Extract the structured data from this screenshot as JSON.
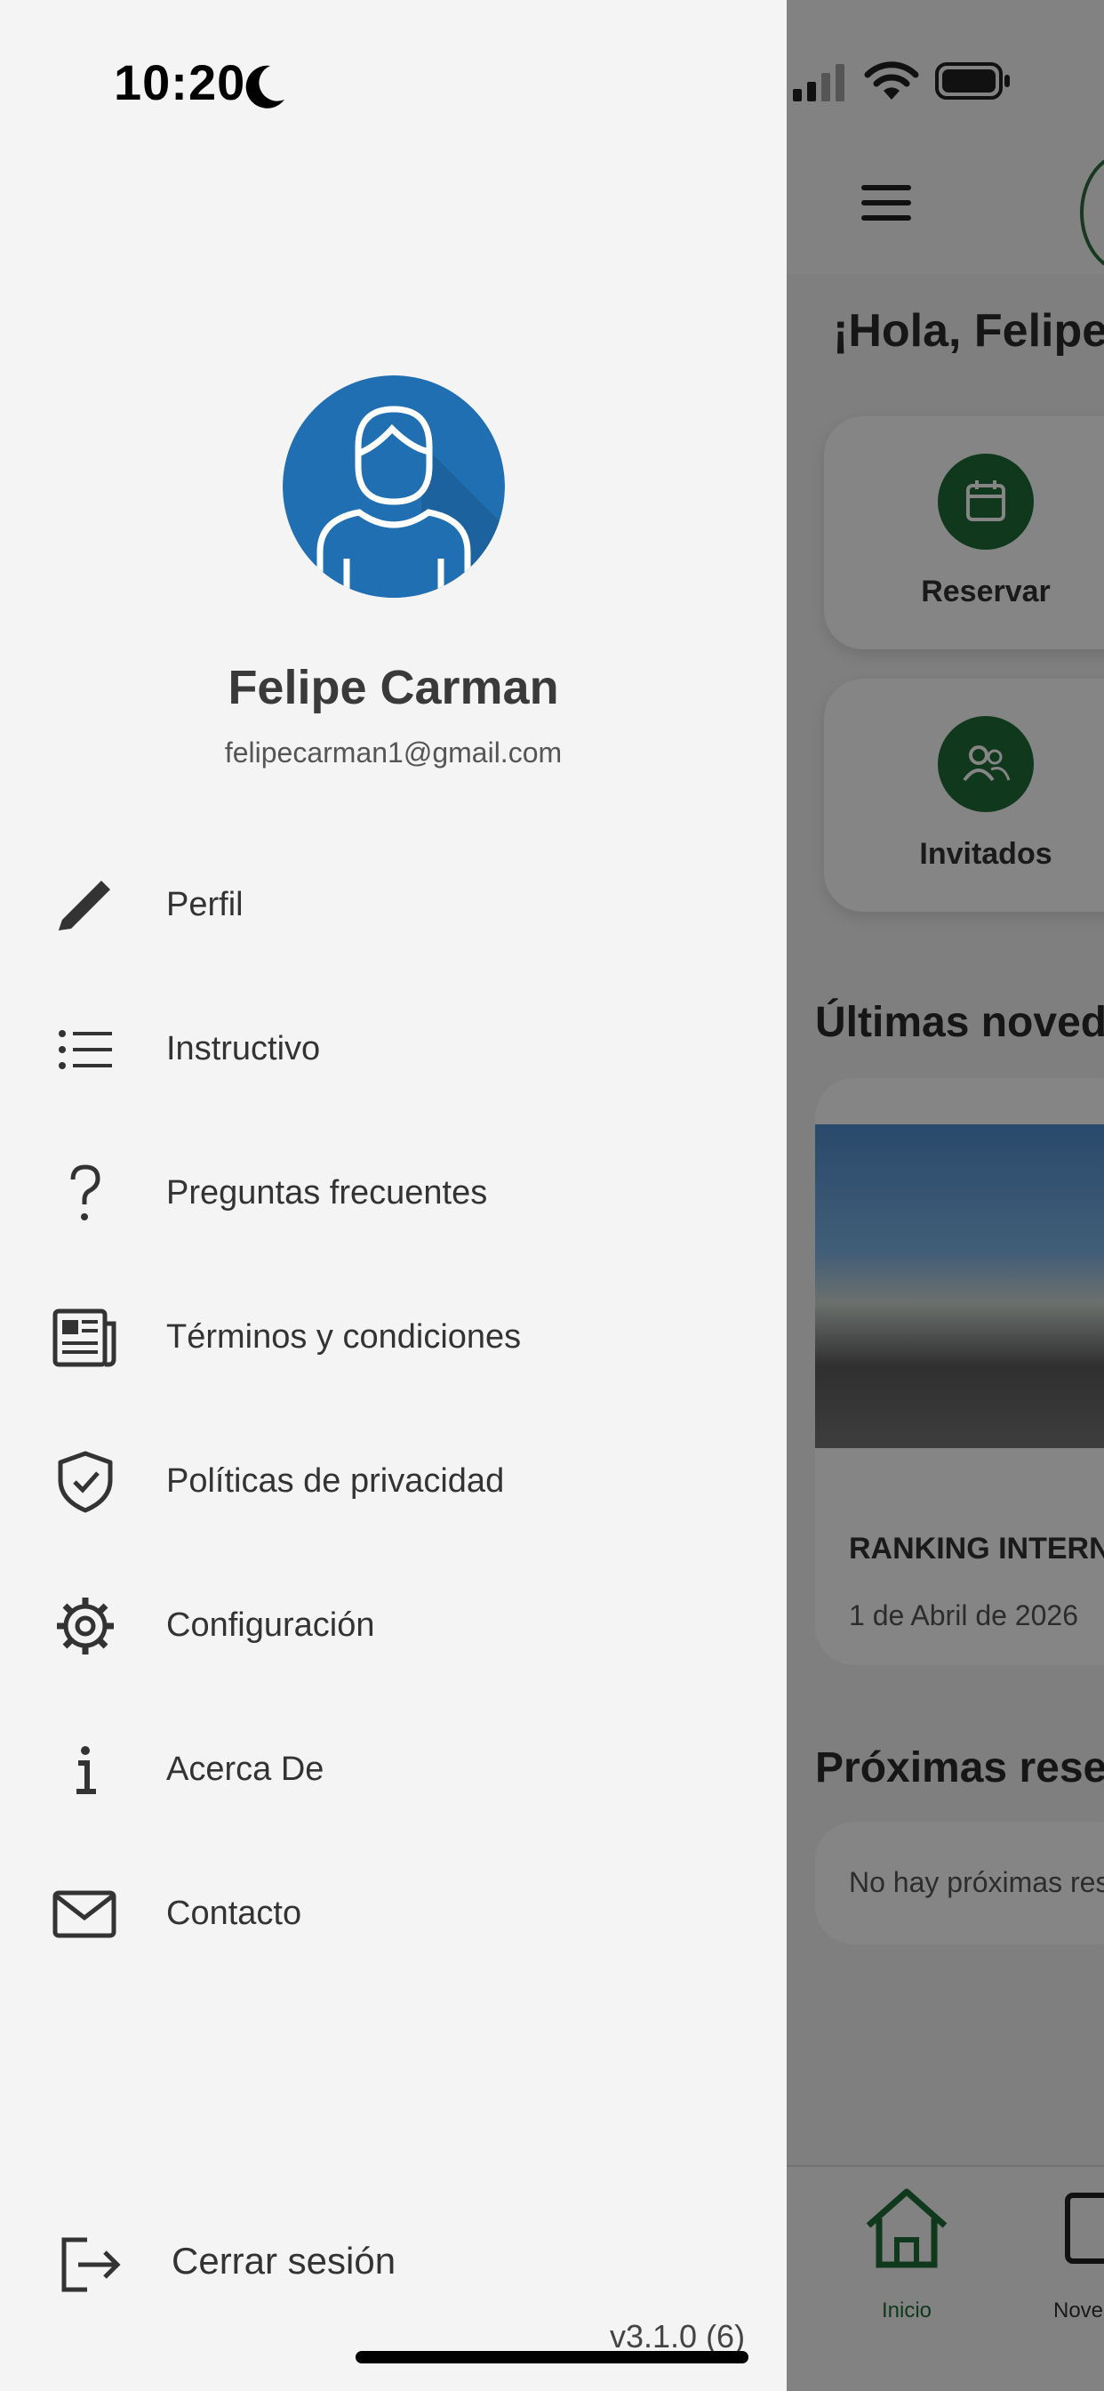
{
  "status_bar": {
    "time": "10:20"
  },
  "drawer": {
    "user": {
      "name": "Felipe Carman",
      "email": "felipecarman1@gmail.com"
    },
    "menu": [
      {
        "label": "Perfil",
        "icon": "pencil-icon"
      },
      {
        "label": "Instructivo",
        "icon": "list-icon"
      },
      {
        "label": "Preguntas frecuentes",
        "icon": "question-mark-icon"
      },
      {
        "label": "Términos y condiciones",
        "icon": "newspaper-icon"
      },
      {
        "label": "Políticas de privacidad",
        "icon": "shield-check-icon"
      },
      {
        "label": "Configuración",
        "icon": "gear-icon"
      },
      {
        "label": "Acerca De",
        "icon": "info-icon"
      },
      {
        "label": "Contacto",
        "icon": "envelope-icon"
      }
    ],
    "logout": {
      "label": "Cerrar sesión",
      "icon": "logout-icon"
    },
    "version": "v3.1.0 (6)"
  },
  "background": {
    "greeting": "¡Hola, Felipe",
    "actions": [
      {
        "label": "Reservar"
      },
      {
        "label": "Invitados"
      }
    ],
    "news_section_title": "Últimas noveda",
    "news": {
      "title": "RANKING INTERN",
      "date": "1 de Abril de 2026"
    },
    "reservations_section_title": "Próximas reser",
    "reservations_empty": "No hay próximas res",
    "tabs": [
      {
        "label": "Inicio"
      },
      {
        "label": "Nove"
      }
    ]
  },
  "colors": {
    "brand_green": "#1f6b36",
    "avatar_blue": "#1f6fb2",
    "drawer_bg": "#f4f4f4"
  }
}
